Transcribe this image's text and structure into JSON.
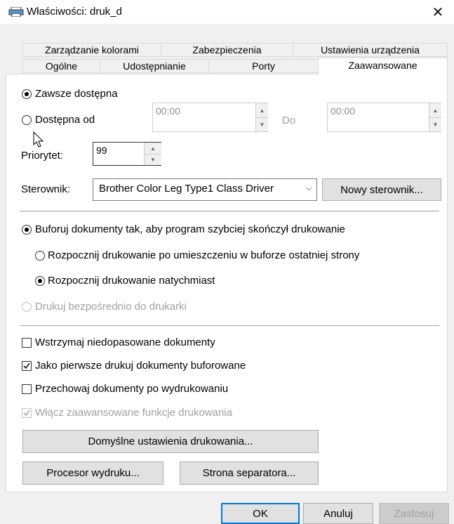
{
  "window": {
    "title": "Właściwości: druk_d",
    "close_glyph": "✕"
  },
  "tabs_row1": [
    {
      "label": "Zarządzanie kolorami"
    },
    {
      "label": "Zabezpieczenia"
    },
    {
      "label": "Ustawienia urządzenia"
    }
  ],
  "tabs_row2": [
    {
      "label": "Ogólne"
    },
    {
      "label": "Udostępnianie"
    },
    {
      "label": "Porty"
    },
    {
      "label": "Zaawansowane",
      "active": true
    }
  ],
  "availability": {
    "always_label": "Zawsze dostępna",
    "from_label": "Dostępna od",
    "from_time": "00:00",
    "to_label": "Do",
    "to_time": "00:00",
    "selected": "always"
  },
  "priority": {
    "label": "Priorytet:",
    "value": "99"
  },
  "driver": {
    "label": "Sterownik:",
    "value": "Brother Color Leg Type1 Class Driver",
    "new_button": "Nowy sterownik..."
  },
  "spool": {
    "spool_label": "Buforuj dokumenty tak, aby program szybciej skończył drukowanie",
    "after_last_page_label": "Rozpocznij drukowanie po umieszczeniu w buforze ostatniej strony",
    "immediately_label": "Rozpocznij drukowanie natychmiast",
    "direct_label": "Drukuj bezpośrednio do drukarki"
  },
  "options": [
    {
      "label": "Wstrzymaj niedopasowane dokumenty",
      "checked": false,
      "disabled": false
    },
    {
      "label": "Jako pierwsze drukuj dokumenty buforowane",
      "checked": true,
      "disabled": false
    },
    {
      "label": "Przechowaj dokumenty po wydrukowaniu",
      "checked": false,
      "disabled": false
    },
    {
      "label": "Włącz zaawansowane funkcje drukowania",
      "checked": true,
      "disabled": true
    }
  ],
  "buttons": {
    "defaults": "Domyślne ustawienia drukowania...",
    "processor": "Procesor wydruku...",
    "separator": "Strona separatora...",
    "ok": "OK",
    "cancel": "Anuluj",
    "apply": "Zastosuj"
  },
  "colors": {
    "accent": "#0078d7",
    "disabled_text": "#a0a0a0"
  }
}
